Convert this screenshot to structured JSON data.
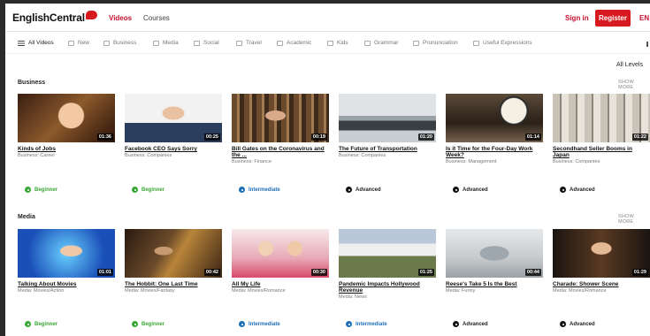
{
  "header": {
    "logo": "EnglishCentral",
    "nav_videos": "Videos",
    "nav_courses": "Courses",
    "signin": "Sign in",
    "register": "Register",
    "lang": "EN"
  },
  "categories": [
    {
      "label": "All Videos",
      "icon": "list-icon"
    },
    {
      "label": "New",
      "icon": "new-icon"
    },
    {
      "label": "Business",
      "icon": "briefcase-icon"
    },
    {
      "label": "Media",
      "icon": "film-icon"
    },
    {
      "label": "Social",
      "icon": "people-icon"
    },
    {
      "label": "Travel",
      "icon": "plane-icon"
    },
    {
      "label": "Academic",
      "icon": "graduation-icon"
    },
    {
      "label": "Kids",
      "icon": "kids-icon"
    },
    {
      "label": "Grammar",
      "icon": "book-icon"
    },
    {
      "label": "Pronunciation",
      "icon": "speech-icon"
    },
    {
      "label": "Useful Expressions",
      "icon": "chat-icon"
    }
  ],
  "all_levels": "All Levels",
  "sections": [
    {
      "title": "Business",
      "show_more": "SHOW MORE",
      "cards": [
        {
          "title": "Kinds of Jobs",
          "subtitle": "Business: Career",
          "duration": "01:36",
          "level": "Beginner",
          "level_type": "beg"
        },
        {
          "title": "Facebook CEO Says Sorry",
          "subtitle": "Business: Companies",
          "duration": "00:25",
          "level": "Beginner",
          "level_type": "beg"
        },
        {
          "title": "Bill Gates on the Coronavirus and the ...",
          "subtitle": "Business: Finance",
          "duration": "00:19",
          "level": "Intermediate",
          "level_type": "int"
        },
        {
          "title": "The Future of Transportation",
          "subtitle": "Business: Companies",
          "duration": "01:20",
          "level": "Advanced",
          "level_type": "adv"
        },
        {
          "title": "Is it Time for the Four-Day Work Week?",
          "subtitle": "Business: Management",
          "duration": "01:14",
          "level": "Advanced",
          "level_type": "adv"
        },
        {
          "title": "Secondhand Seller Booms in Japan",
          "subtitle": "Business: Companies",
          "duration": "01:22",
          "level": "Advanced",
          "level_type": "adv"
        }
      ]
    },
    {
      "title": "Media",
      "show_more": "SHOW MORE",
      "cards": [
        {
          "title": "Talking About Movies",
          "subtitle": "Media: Movies/Action",
          "duration": "01:01",
          "level": "Beginner",
          "level_type": "beg"
        },
        {
          "title": "The Hobbit: One Last Time",
          "subtitle": "Media: Movies/Fantasy",
          "duration": "00:42",
          "level": "Beginner",
          "level_type": "beg"
        },
        {
          "title": "All My Life",
          "subtitle": "Media: Movies/Romance",
          "duration": "00:30",
          "level": "Intermediate",
          "level_type": "int"
        },
        {
          "title": "Pandemic Impacts Hollywood Revenue",
          "subtitle": "Media: News",
          "duration": "01:25",
          "level": "Intermediate",
          "level_type": "int"
        },
        {
          "title": "Reese's Take 5 Is the Best",
          "subtitle": "Media: Funny",
          "duration": "00:44",
          "level": "Advanced",
          "level_type": "adv"
        },
        {
          "title": "Charade: Shower Scene",
          "subtitle": "Media: Movies/Romance",
          "duration": "01:29",
          "level": "Advanced",
          "level_type": "adv"
        }
      ]
    }
  ],
  "colors": {
    "brand_red": "#d71920",
    "beginner": "#3aa635",
    "intermediate": "#1f6fb8",
    "advanced": "#111111"
  }
}
